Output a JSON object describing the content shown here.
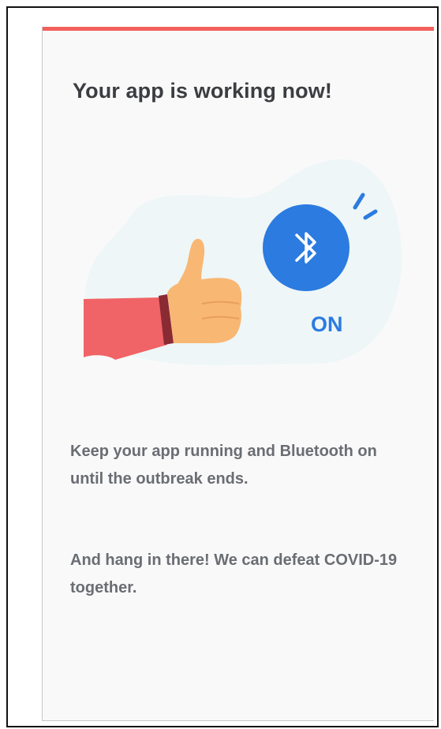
{
  "colors": {
    "accent_bar": "#f2605c",
    "bluetooth_blue": "#2b7be0",
    "blob_bg": "#eef6f7",
    "sleeve_red": "#f06366",
    "cuff_dark": "#8a2a33",
    "hand_skin": "#f8b773",
    "title_text": "#3b3d40",
    "body_text": "#6a6d72"
  },
  "card": {
    "title": "Your app is working now!",
    "illustration": {
      "icon": "bluetooth-icon",
      "hand_icon": "thumbs-up-icon",
      "status_label": "ON"
    },
    "paragraphs": [
      "Keep your app running and Bluetooth on until the outbreak ends.",
      "And hang in there! We can defeat COVID-19 together."
    ]
  }
}
